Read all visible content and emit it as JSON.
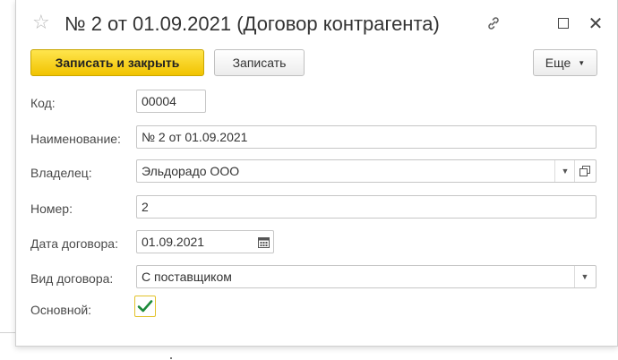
{
  "window": {
    "title": "№ 2 от 01.09.2021 (Договор контрагента)"
  },
  "toolbar": {
    "save_close_label": "Записать и закрыть",
    "save_label": "Записать",
    "more_label": "Еще"
  },
  "form": {
    "code": {
      "label": "Код:",
      "value": "00004"
    },
    "name": {
      "label": "Наименование:",
      "value": "№ 2 от 01.09.2021"
    },
    "owner": {
      "label": "Владелец:",
      "value": "Эльдорадо ООО"
    },
    "number": {
      "label": "Номер:",
      "value": "2"
    },
    "contract_date": {
      "label": "Дата договора:",
      "value": "01.09.2021"
    },
    "contract_type": {
      "label": "Вид договора:",
      "value": "С поставщиком"
    },
    "main": {
      "label": "Основной:",
      "checked": true
    }
  },
  "colors": {
    "primary_button": "#f5cd12",
    "check": "#1d8a3a"
  }
}
